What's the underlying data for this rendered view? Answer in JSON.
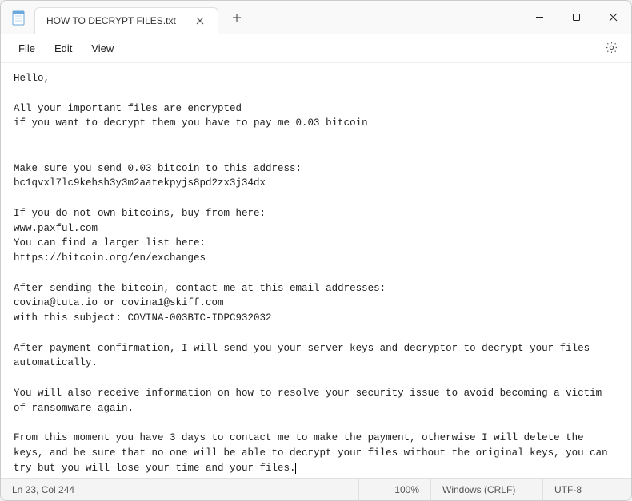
{
  "titlebar": {
    "tab_title": "HOW TO DECRYPT FILES.txt"
  },
  "menubar": {
    "file": "File",
    "edit": "Edit",
    "view": "View"
  },
  "content": {
    "text": "Hello,\n\nAll your important files are encrypted\nif you want to decrypt them you have to pay me 0.03 bitcoin\n\n\nMake sure you send 0.03 bitcoin to this address:\nbc1qvxl7lc9kehsh3y3m2aatekpyjs8pd2zx3j34dx\n\nIf you do not own bitcoins, buy from here:\nwww.paxful.com\nYou can find a larger list here:\nhttps://bitcoin.org/en/exchanges\n\nAfter sending the bitcoin, contact me at this email addresses:\ncovina@tuta.io or covina1@skiff.com\nwith this subject: COVINA-003BTC-IDPC932032\n\nAfter payment confirmation, I will send you your server keys and decryptor to decrypt your files automatically.\n\nYou will also receive information on how to resolve your security issue to avoid becoming a victim of ransomware again.\n\nFrom this moment you have 3 days to contact me to make the payment, otherwise I will delete the keys, and be sure that no one will be able to decrypt your files without the original keys, you can try but you will lose your time and your files."
  },
  "statusbar": {
    "position": "Ln 23, Col 244",
    "zoom": "100%",
    "line_ending": "Windows (CRLF)",
    "encoding": "UTF-8"
  }
}
